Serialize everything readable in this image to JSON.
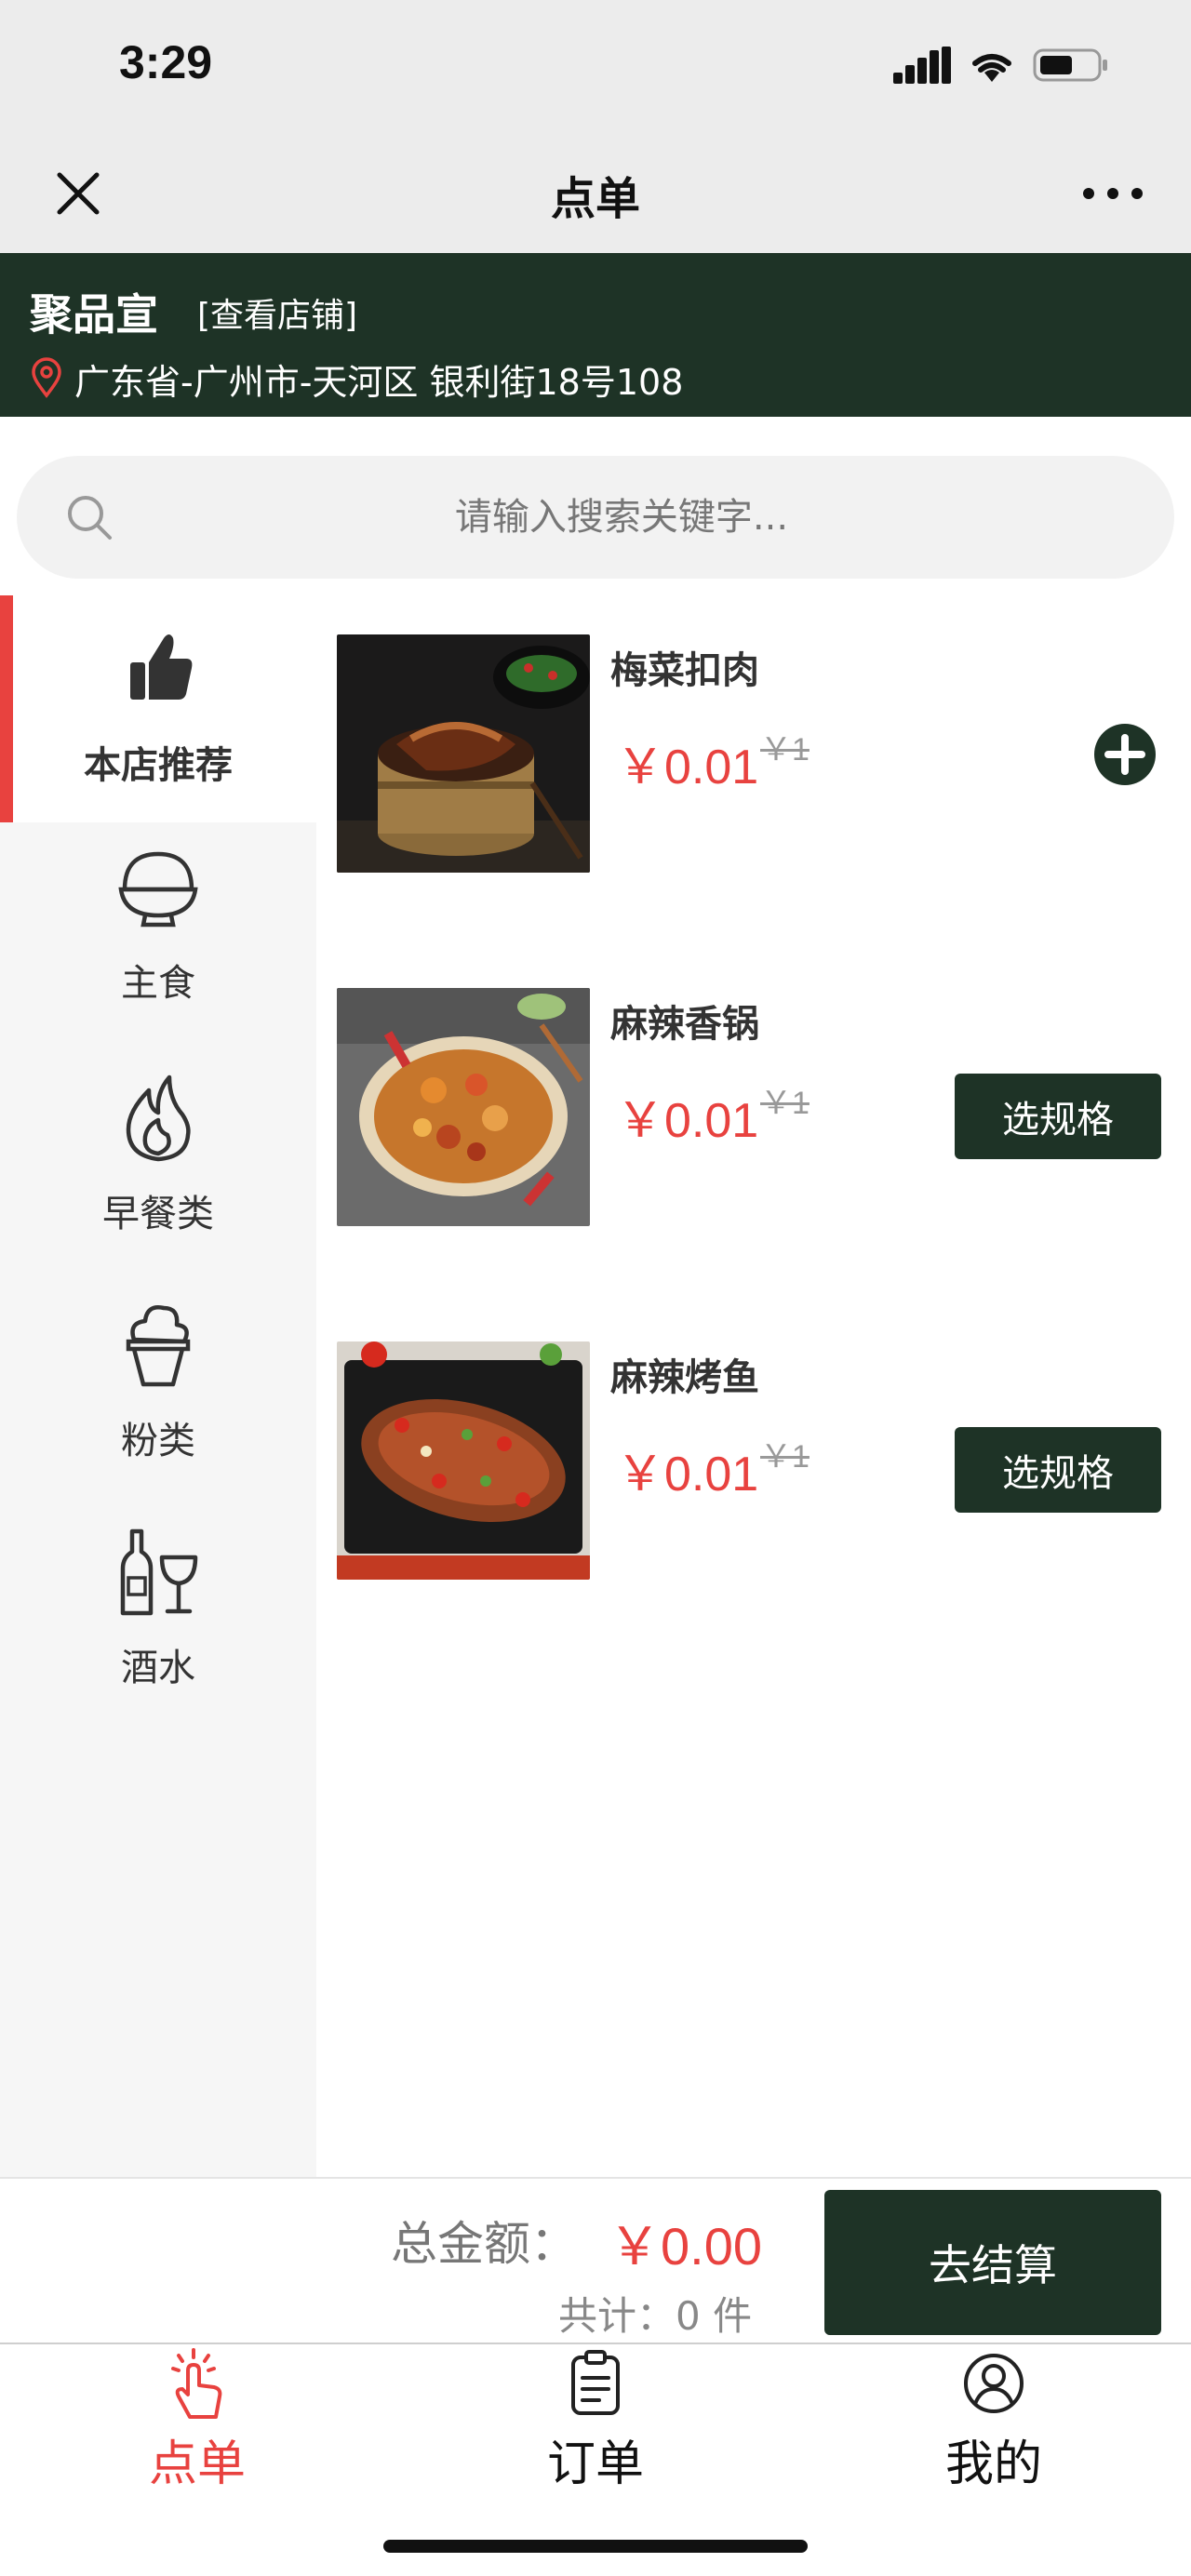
{
  "status_bar": {
    "time": "3:29"
  },
  "nav": {
    "title": "点单"
  },
  "store": {
    "name": "聚品宣",
    "view_link": "[查看店铺]",
    "address": "广东省-广州市-天河区 银利街18号108"
  },
  "search": {
    "placeholder": "请输入搜索关键字..."
  },
  "categories": [
    {
      "label": "本店推荐",
      "icon": "thumbs-up-icon",
      "active": true
    },
    {
      "label": "主食",
      "icon": "rice-bowl-icon"
    },
    {
      "label": "早餐类",
      "icon": "flame-icon"
    },
    {
      "label": "粉类",
      "icon": "ice-cream-icon"
    },
    {
      "label": "酒水",
      "icon": "wine-bottle-glass-icon"
    }
  ],
  "products": [
    {
      "name": "梅菜扣肉",
      "price": "￥0.01",
      "original_price": "￥1",
      "action": "add",
      "action_icon": "plus-circle-icon"
    },
    {
      "name": "麻辣香锅",
      "price": "￥0.01",
      "original_price": "￥1",
      "action": "spec",
      "action_label": "选规格"
    },
    {
      "name": "麻辣烤鱼",
      "price": "￥0.01",
      "original_price": "￥1",
      "action": "spec",
      "action_label": "选规格"
    }
  ],
  "cart": {
    "total_label": "总金额：",
    "total_value": "￥0.00",
    "count_text": "共计：0 件",
    "checkout_label": "去结算"
  },
  "tabs": [
    {
      "label": "点单",
      "icon": "tap-hand-icon",
      "active": true
    },
    {
      "label": "订单",
      "icon": "clipboard-icon"
    },
    {
      "label": "我的",
      "icon": "user-circle-icon"
    }
  ],
  "colors": {
    "brand_dark_green": "#1e3326",
    "accent_red": "#e8423f",
    "nav_gray": "#ececec"
  }
}
